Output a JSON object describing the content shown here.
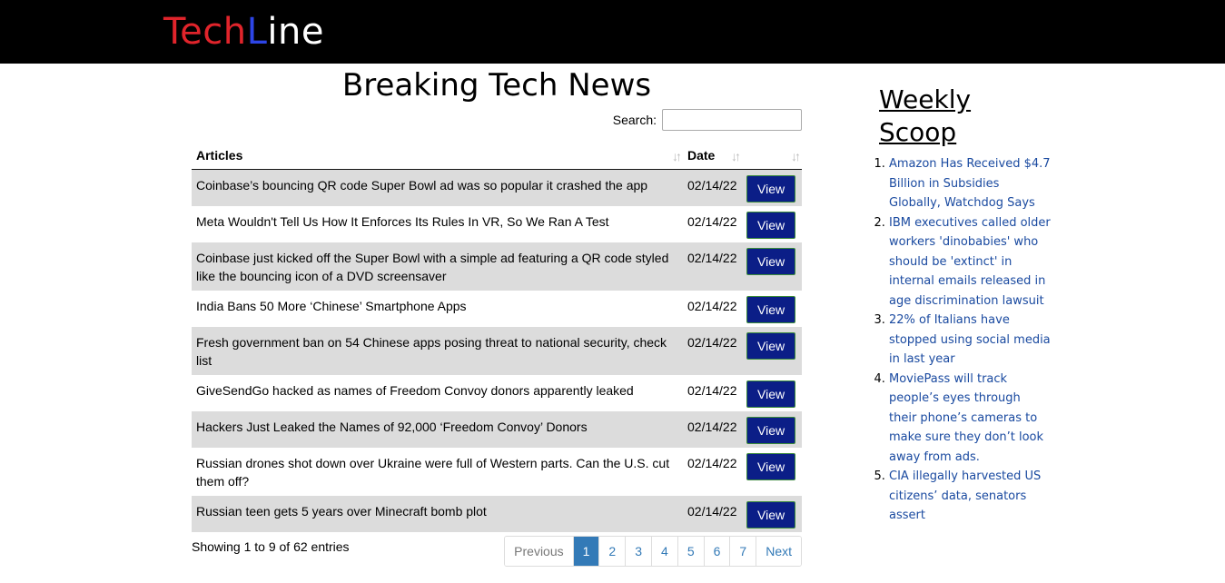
{
  "brand": {
    "part1": "Tech",
    "part2": "L",
    "part3": "ine"
  },
  "page_title": "Breaking Tech News",
  "search": {
    "label": "Search:",
    "value": "",
    "placeholder": ""
  },
  "table": {
    "headers": {
      "articles": "Articles",
      "date": "Date"
    },
    "view_label": "View",
    "rows": [
      {
        "title": "Coinbase’s bouncing QR code Super Bowl ad was so popular it crashed the app",
        "date": "02/14/22"
      },
      {
        "title": "Meta Wouldn't Tell Us How It Enforces Its Rules In VR, So We Ran A Test",
        "date": "02/14/22"
      },
      {
        "title": "Coinbase just kicked off the Super Bowl with a simple ad featuring a QR code styled like the bouncing icon of a DVD screensaver",
        "date": "02/14/22"
      },
      {
        "title": "India Bans 50 More ‘Chinese’ Smartphone Apps",
        "date": "02/14/22"
      },
      {
        "title": "Fresh government ban on 54 Chinese apps posing threat to national security, check list",
        "date": "02/14/22"
      },
      {
        "title": "GiveSendGo hacked as names of Freedom Convoy donors apparently leaked",
        "date": "02/14/22"
      },
      {
        "title": "Hackers Just Leaked the Names of 92,000 ‘Freedom Convoy’ Donors",
        "date": "02/14/22"
      },
      {
        "title": "Russian drones shot down over Ukraine were full of Western parts. Can the U.S. cut them off?",
        "date": "02/14/22"
      },
      {
        "title": "Russian teen gets 5 years over Minecraft bomb plot",
        "date": "02/14/22"
      }
    ]
  },
  "info_text": "Showing 1 to 9 of 62 entries",
  "pagination": {
    "previous": "Previous",
    "pages": [
      "1",
      "2",
      "3",
      "4",
      "5",
      "6",
      "7"
    ],
    "active_page": "1",
    "next": "Next"
  },
  "sidebar": {
    "title": "Weekly Scoop",
    "items": [
      "Amazon Has Received $4.7 Billion in Subsidies Globally, Watchdog Says",
      "IBM executives called older workers 'dinobabies' who should be 'extinct' in internal emails released in age discrimination lawsuit",
      "22% of Italians have stopped using social media in last year",
      "MoviePass will track people’s eyes through their phone’s cameras to make sure they don’t look away from ads.",
      "CIA illegally harvested US citizens’ data, senators assert"
    ]
  },
  "colors": {
    "header_bg": "#000000",
    "logo_red": "#e0242b",
    "logo_blue": "#2d45e6",
    "button_bg": "#0b1e87",
    "link": "#337ab7",
    "row_stripe": "#dcdcdc"
  }
}
